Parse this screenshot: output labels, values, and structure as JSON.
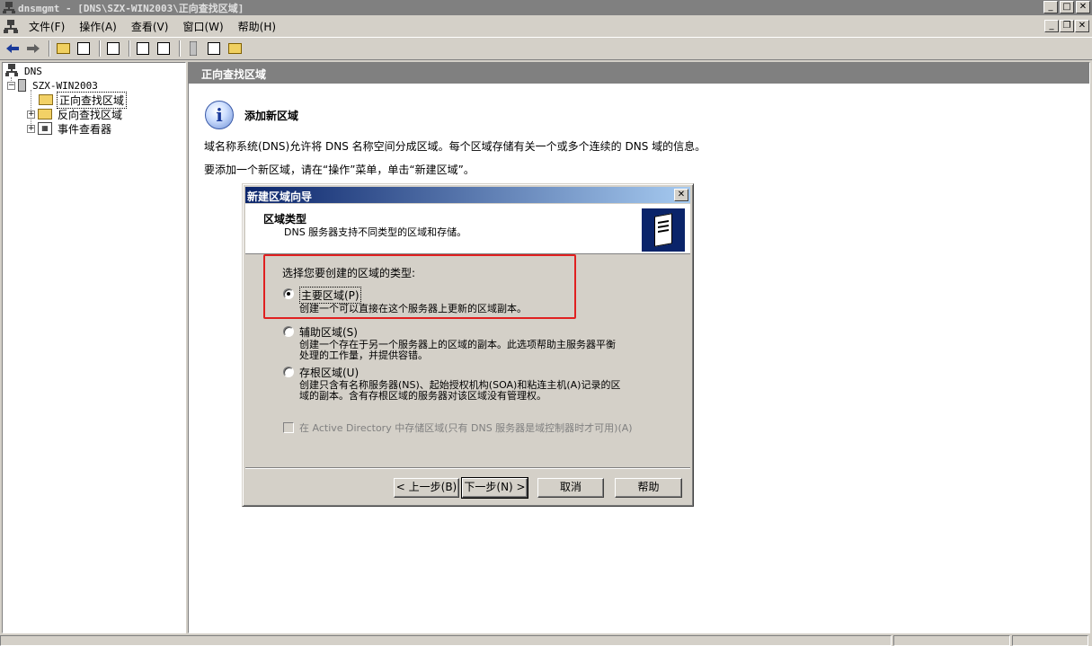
{
  "window": {
    "title": "dnsmgmt - [DNS\\SZX-WIN2003\\正向查找区域]"
  },
  "menu": {
    "items": [
      {
        "label": "文件(F)"
      },
      {
        "label": "操作(A)"
      },
      {
        "label": "查看(V)"
      },
      {
        "label": "窗口(W)"
      },
      {
        "label": "帮助(H)"
      }
    ]
  },
  "toolbar": {
    "icons": [
      "back-arrow-icon",
      "forward-arrow-icon",
      "up-folder-icon",
      "show-tree-icon",
      "refresh-icon",
      "properties-icon",
      "help-icon",
      "server-icon",
      "list-icon",
      "event-icon"
    ]
  },
  "tree": {
    "root": "DNS",
    "server": "SZX-WIN2003",
    "forward_zone": "正向查找区域",
    "reverse_zone": "反向查找区域",
    "event_viewer": "事件查看器"
  },
  "pane": {
    "header": "正向查找区域",
    "info_title": "添加新区域",
    "desc1": "域名称系统(DNS)允许将 DNS 名称空间分成区域。每个区域存储有关一个或多个连续的 DNS 域的信息。",
    "desc2": "要添加一个新区域，请在“操作”菜单，单击“新建区域”。"
  },
  "dialog": {
    "title": "新建区域向导",
    "close": "✕",
    "header_title": "区域类型",
    "header_subtitle": "DNS 服务器支持不同类型的区域和存储。",
    "choose_label": "选择您要创建的区域的类型:",
    "options": [
      {
        "label": "主要区域(P)",
        "desc1": "创建一个可以直接在这个服务器上更新的区域副本。",
        "desc2": "",
        "selected": true
      },
      {
        "label": "辅助区域(S)",
        "desc1": "创建一个存在于另一个服务器上的区域的副本。此选项帮助主服务器平衡",
        "desc2": "处理的工作量，并提供容错。",
        "selected": false
      },
      {
        "label": "存根区域(U)",
        "desc1": "创建只含有名称服务器(NS)、起始授权机构(SOA)和粘连主机(A)记录的区",
        "desc2": "域的副本。含有存根区域的服务器对该区域没有管理权。",
        "selected": false
      }
    ],
    "ad_checkbox": "在 Active Directory 中存储区域(只有 DNS 服务器是域控制器时才可用)(A)",
    "buttons": {
      "back": "< 上一步(B)",
      "next": "下一步(N) >",
      "cancel": "取消",
      "help": "帮助"
    }
  },
  "colors": {
    "highlight": "#e02020",
    "dialog_title_start": "#0a246a",
    "pane_header": "#808080"
  }
}
